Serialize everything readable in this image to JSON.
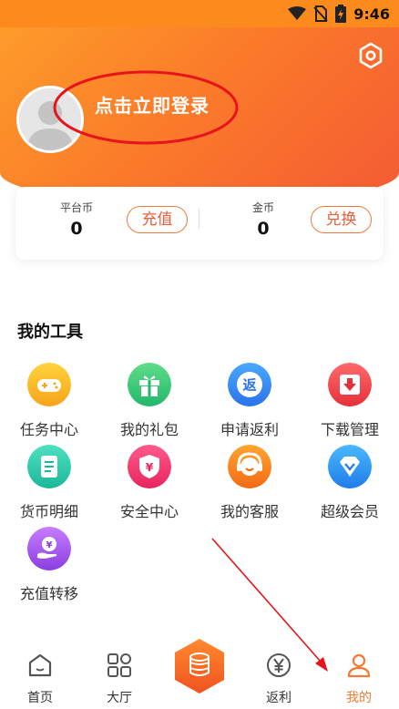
{
  "status_bar": {
    "time": "9:46"
  },
  "header": {
    "login_text": "点击立即登录"
  },
  "balance": {
    "platform": {
      "label": "平台币",
      "value": "0",
      "button": "充值"
    },
    "gold": {
      "label": "金币",
      "value": "0",
      "button": "兑换"
    }
  },
  "tools": {
    "title": "我的工具",
    "items": [
      {
        "label": "任务中心",
        "icon": "gamepad-icon"
      },
      {
        "label": "我的礼包",
        "icon": "gift-icon"
      },
      {
        "label": "申请返利",
        "icon": "rebate-icon",
        "glyph": "返"
      },
      {
        "label": "下载管理",
        "icon": "download-icon"
      },
      {
        "label": "货币明细",
        "icon": "document-icon"
      },
      {
        "label": "安全中心",
        "icon": "shield-icon",
        "glyph": "¥"
      },
      {
        "label": "我的客服",
        "icon": "headset-icon"
      },
      {
        "label": "超级会员",
        "icon": "diamond-icon"
      },
      {
        "label": "充值转移",
        "icon": "hand-coin-icon",
        "glyph": "¥"
      }
    ]
  },
  "bottom_nav": {
    "items": [
      {
        "label": "首页",
        "icon": "home-icon"
      },
      {
        "label": "大厅",
        "icon": "grid-icon"
      },
      {
        "label": "返利",
        "icon": "yen-circle-icon"
      },
      {
        "label": "我的",
        "icon": "user-icon",
        "active": true
      }
    ],
    "center_icon": "coins-icon"
  },
  "colors": {
    "accent": "#f37a34",
    "header_start": "#fd9b2a",
    "header_end": "#f45a34",
    "annotation": "#e8141b"
  }
}
